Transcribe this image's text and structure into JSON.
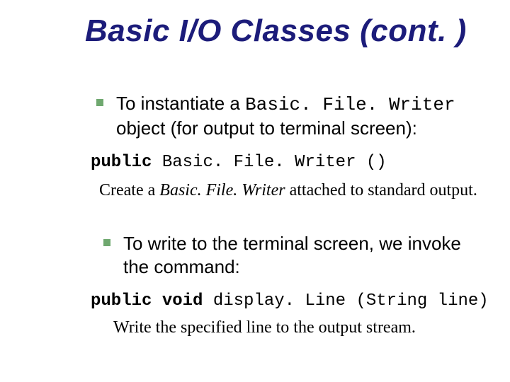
{
  "title": "Basic I/O Classes (cont. )",
  "bullet1": {
    "pre": "To instantiate a ",
    "mono": "Basic. File. Writer",
    "post": " object (for output to terminal screen):"
  },
  "code1": {
    "kw": "public ",
    "rest": "Basic. File. Writer ()"
  },
  "desc1": {
    "pre": "Create a ",
    "it": "Basic. File. Writer",
    "post": " attached to standard output."
  },
  "bullet2": "To write to the terminal screen, we invoke the command:",
  "code2": {
    "kw": "public void ",
    "rest": "display. Line (String line)"
  },
  "desc2": "Write the specified line to the output stream."
}
